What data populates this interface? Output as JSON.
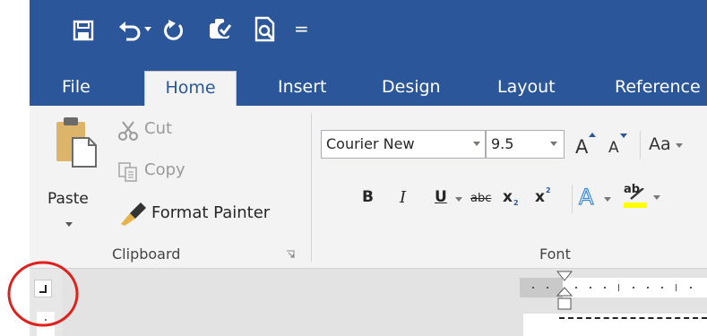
{
  "qat": {
    "more_glyph": "="
  },
  "tabs": {
    "items": [
      "File",
      "Home",
      "Insert",
      "Design",
      "Layout",
      "Reference"
    ]
  },
  "clipboard": {
    "paste": "Paste",
    "cut": "Cut",
    "copy": "Copy",
    "format_painter": "Format Painter",
    "group_label": "Clipboard"
  },
  "font": {
    "font_name": "Courier New",
    "font_size": "9.5",
    "grow_glyph": "A",
    "shrink_glyph": "A",
    "change_case": "Aa",
    "bold": "B",
    "italic": "I",
    "underline": "U",
    "strike": "abc",
    "sub": "x",
    "sup": "x",
    "effects_glyph": "A",
    "highlight_glyph": "ab",
    "group_label": "Font"
  },
  "colors": {
    "accent": "#2b579a",
    "ribbon": "#f3f3f3",
    "annotation": "#e0201b",
    "highlight": "#ffff00"
  }
}
